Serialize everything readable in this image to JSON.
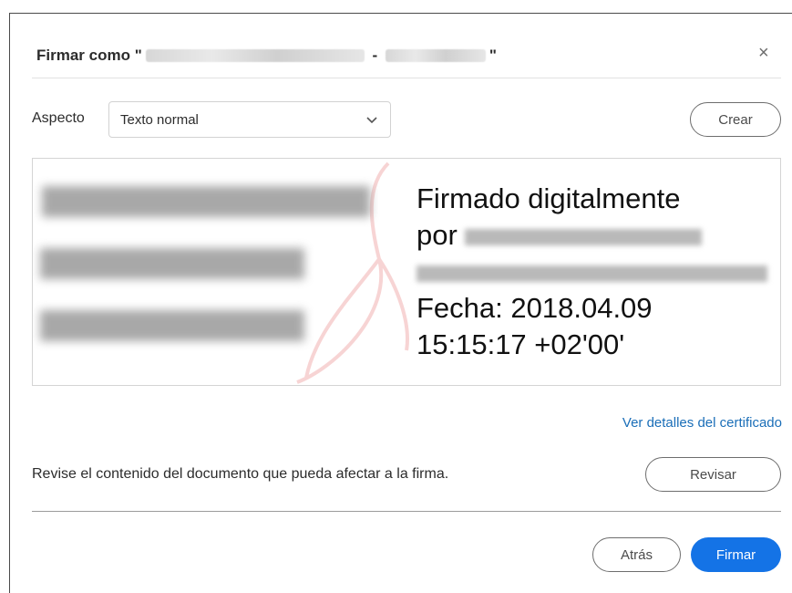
{
  "dialog": {
    "title_prefix": "Firmar como \"",
    "title_sep": " - ",
    "title_suffix": "\"",
    "close_glyph": "×"
  },
  "appearance": {
    "label": "Aspecto",
    "selected": "Texto normal",
    "create_label": "Crear"
  },
  "preview": {
    "line1": "Firmado digitalmente",
    "line2": "por",
    "line4": "Fecha: 2018.04.09",
    "line5": "15:15:17 +02'00'"
  },
  "certificate_link": "Ver detalles del certificado",
  "review": {
    "text": "Revise el contenido del documento que pueda afectar a la firma.",
    "button": "Revisar"
  },
  "footer": {
    "back": "Atrás",
    "sign": "Firmar"
  },
  "colors": {
    "accent": "#1473e6",
    "link": "#1a6eb8"
  }
}
